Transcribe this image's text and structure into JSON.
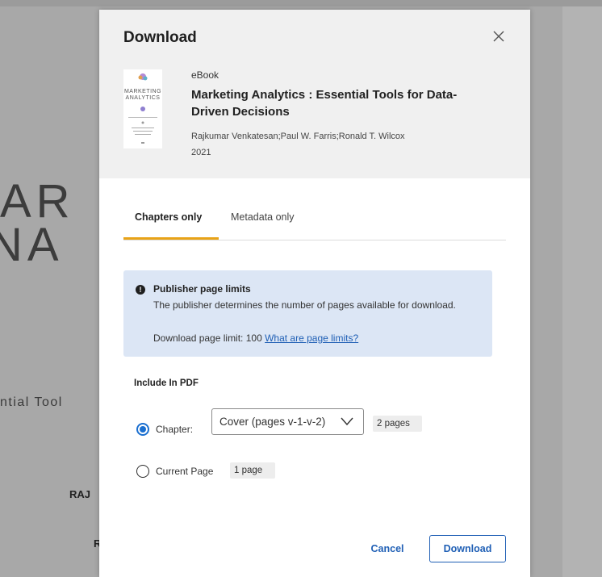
{
  "background": {
    "big_line1": "AR",
    "big_line2": "NA",
    "subtitle_fragment": "ntial Tool",
    "author_fragment_1": "RAJ",
    "author_fragment_2": "R"
  },
  "modal": {
    "title": "Download",
    "close_icon": "close-icon",
    "book": {
      "cover_line1": "MARKETING",
      "cover_line2": "ANALYTICS",
      "type": "eBook",
      "title": "Marketing Analytics : Essential Tools for Data-Driven Decisions",
      "authors": "Rajkumar Venkatesan;Paul W. Farris;Ronald T. Wilcox",
      "year": "2021"
    },
    "tabs": [
      {
        "label": "Chapters only",
        "active": true
      },
      {
        "label": "Metadata only",
        "active": false
      }
    ],
    "notice": {
      "icon": "exclamation-icon",
      "title": "Publisher page limits",
      "body": "The publisher determines the number of pages available for download.",
      "limit_text": "Download page limit: 100",
      "link_text": "What are page limits?"
    },
    "include_label": "Include In PDF",
    "options": {
      "chapter_label": "Chapter:",
      "chapter_selected": true,
      "chapter_value": "Cover (pages v-1-v-2)",
      "chapter_pages": "2 pages",
      "current_label": "Current Page",
      "current_selected": false,
      "current_pages": "1 page"
    },
    "buttons": {
      "cancel": "Cancel",
      "download": "Download"
    },
    "colors": {
      "accent_tab": "#e8a317",
      "link_blue": "#1f5fb5",
      "radio_blue": "#1a6fd0",
      "notice_bg": "#dce6f5"
    }
  }
}
